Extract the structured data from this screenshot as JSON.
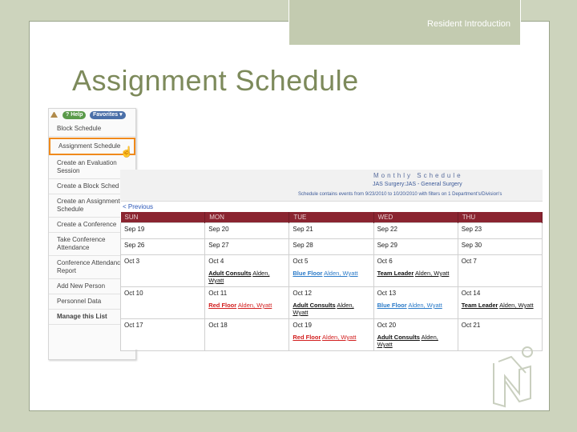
{
  "header": {
    "label": "Resident Introduction"
  },
  "slide_title": "Assignment Schedule",
  "menu": {
    "help": "? Help",
    "favorites": "Favorites ▾",
    "items": [
      {
        "label": "Block Schedule"
      },
      {
        "label": "Assignment Schedule"
      },
      {
        "label": "Create an Evaluation Session"
      },
      {
        "label": "Create a Block Sched"
      },
      {
        "label": "Create an Assignment Schedule"
      },
      {
        "label": "Create a Conference"
      },
      {
        "label": "Take Conference Attendance"
      },
      {
        "label": "Conference Attendance Report"
      },
      {
        "label": "Add New Person"
      },
      {
        "label": "Personnel Data"
      },
      {
        "label": "Manage this List"
      }
    ]
  },
  "schedule": {
    "title": "Monthly Schedule",
    "subtitle": "JAS Surgery:JAS - General Surgery",
    "filter_note": "Schedule contains events from 9/23/2010 to 10/20/2010 with filters on 1 Department's/Division's",
    "prev_link": "< Previous",
    "days": [
      "SUN",
      "MON",
      "TUE",
      "WED",
      "THU"
    ],
    "weeks": [
      [
        {
          "date": "Sep 19"
        },
        {
          "date": "Sep 20"
        },
        {
          "date": "Sep 21"
        },
        {
          "date": "Sep 22"
        },
        {
          "date": "Sep 23"
        }
      ],
      [
        {
          "date": "Sep 26"
        },
        {
          "date": "Sep 27"
        },
        {
          "date": "Sep 28"
        },
        {
          "date": "Sep 29"
        },
        {
          "date": "Sep 30"
        }
      ],
      [
        {
          "date": "Oct 3"
        },
        {
          "date": "Oct 4",
          "event": "Adult Consults",
          "person": "Alden, Wyatt",
          "kind": "adult"
        },
        {
          "date": "Oct 5",
          "event": "Blue Floor",
          "person": "Alden, Wyatt",
          "kind": "blue"
        },
        {
          "date": "Oct 6",
          "event": "Team Leader",
          "person": "Alden, Wyatt",
          "kind": "team"
        },
        {
          "date": "Oct 7"
        }
      ],
      [
        {
          "date": "Oct 10"
        },
        {
          "date": "Oct 11",
          "event": "Red Floor",
          "person": "Alden, Wyatt",
          "kind": "red"
        },
        {
          "date": "Oct 12",
          "event": "Adult Consults",
          "person": "Alden, Wyatt",
          "kind": "adult"
        },
        {
          "date": "Oct 13",
          "event": "Blue Floor",
          "person": "Alden, Wyatt",
          "kind": "blue"
        },
        {
          "date": "Oct 14",
          "event": "Team Leader",
          "person": "Alden, Wyatt",
          "kind": "team"
        }
      ],
      [
        {
          "date": "Oct 17"
        },
        {
          "date": "Oct 18"
        },
        {
          "date": "Oct 19",
          "event": "Red Floor",
          "person": "Alden, Wyatt",
          "kind": "red"
        },
        {
          "date": "Oct 20",
          "event": "Adult Consults",
          "person": "Alden, Wyatt",
          "kind": "adult"
        },
        {
          "date": "Oct 21"
        }
      ]
    ]
  },
  "colors": {
    "accent_title": "#7d8a5b",
    "calendar_header": "#8a2430",
    "active_border": "#f08a1c",
    "blue_event": "#2a7ac8",
    "red_event": "#d21e1e"
  }
}
